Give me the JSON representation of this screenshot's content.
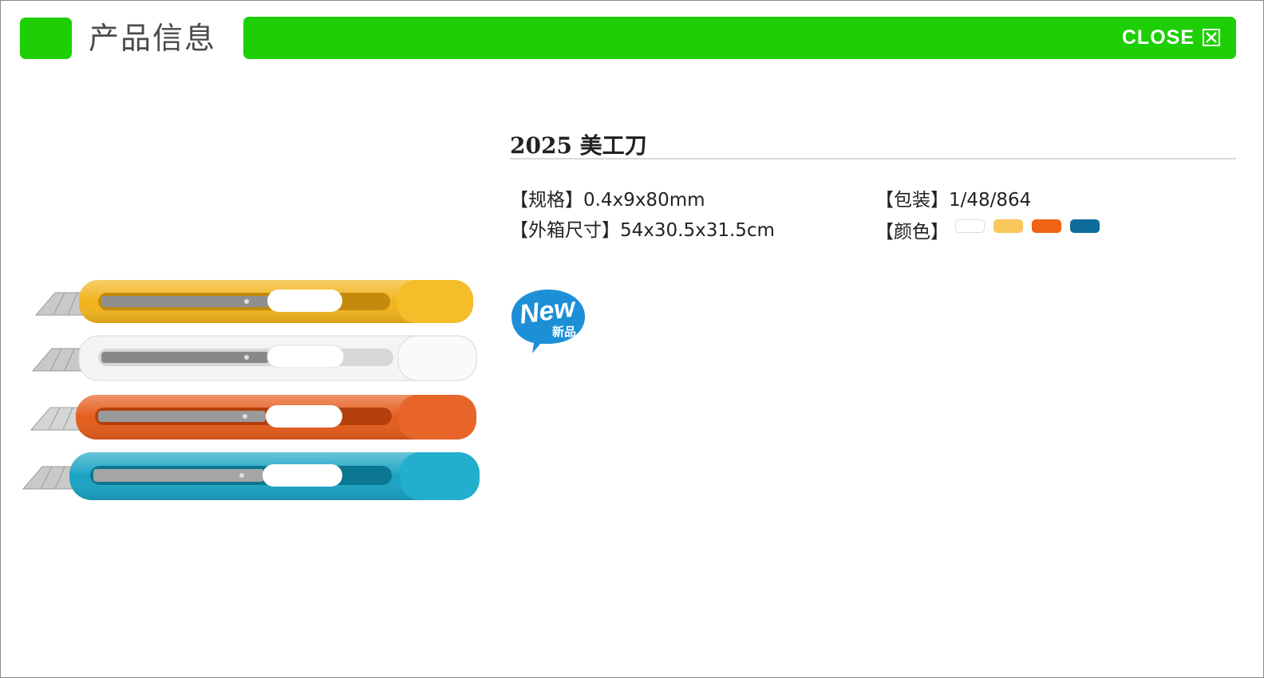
{
  "header": {
    "title": "产品信息",
    "close_label": "CLOSE"
  },
  "product": {
    "title": "2025 美工刀",
    "spec_label": "【规格】",
    "spec_value": "0.4x9x80mm",
    "carton_label": "【外箱尺寸】",
    "carton_value": "54x30.5x31.5cm",
    "pack_label": "【包装】",
    "pack_value": "1/48/864",
    "color_label": "【颜色】",
    "colors": [
      "#ffffff",
      "#f9c75b",
      "#f06312",
      "#0e6c9c"
    ],
    "badge_text": "New",
    "badge_subtext": "新品"
  },
  "theme": {
    "accent": "#1dcf04"
  }
}
